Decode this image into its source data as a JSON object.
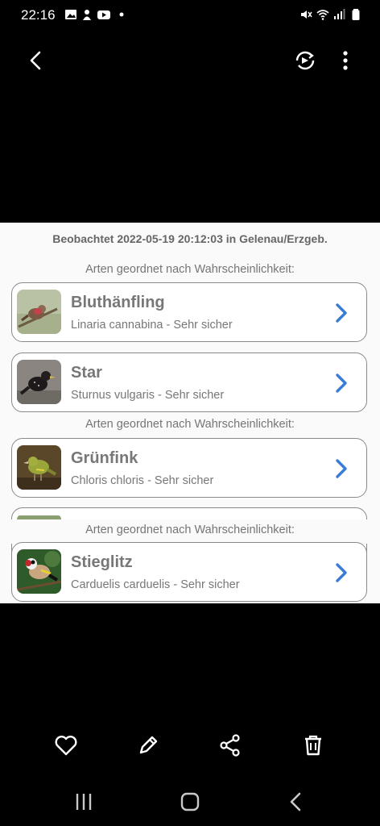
{
  "status_bar": {
    "time": "22:16"
  },
  "panel": {
    "observed": "Beobachtet 2022-05-19 20:12:03 in Gelenau/Erzgeb.",
    "section_label": "Arten geordnet nach Wahrscheinlichkeit:",
    "species": [
      {
        "name": "Bluthänfling",
        "latin": "Linaria cannabina - Sehr sicher"
      },
      {
        "name": "Star",
        "latin": "Sturnus vulgaris - Sehr sicher"
      },
      {
        "name": "Grünfink",
        "latin": "Chloris chloris - Sehr sicher"
      },
      {
        "name": "Stieglitz",
        "latin": "Carduelis carduelis - Sehr sicher"
      }
    ]
  },
  "colors": {
    "chevron": "#3a7bd5",
    "panel_bg": "#fafafa",
    "card_border": "#8a8a8a"
  }
}
